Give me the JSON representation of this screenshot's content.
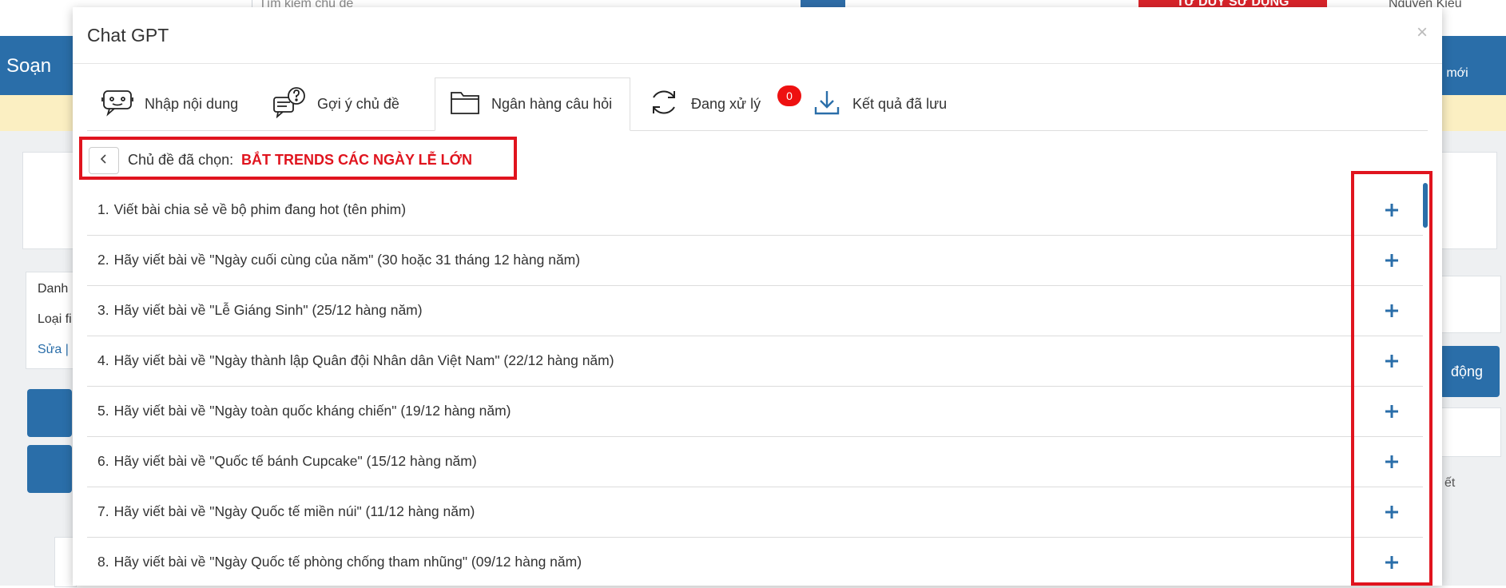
{
  "background": {
    "search_placeholder": "Tìm kiếm chủ đề",
    "promo_label": "TƯ DUY SỬ DỤNG",
    "user_name": "Nguyen Kieu",
    "left_nav_label": "Soạn",
    "right_nav_label": "u mới",
    "list_items": [
      "Danh",
      "Loại fi",
      "Sửa |"
    ],
    "right_button_label": "động",
    "right_text": "ết"
  },
  "modal": {
    "title": "Chat GPT",
    "close_glyph": "×"
  },
  "tabs": [
    {
      "label": "Nhập nội dung",
      "icon": "chat-bot-icon"
    },
    {
      "label": "Gợi ý chủ đề",
      "icon": "question-chat-icon"
    },
    {
      "label": "Ngân hàng câu hỏi",
      "icon": "folder-icon",
      "active": true
    },
    {
      "label": "Đang xử lý",
      "icon": "refresh-icon",
      "badge": "0"
    },
    {
      "label": "Kết quả đã lưu",
      "icon": "download-icon"
    }
  ],
  "selected": {
    "label": "Chủ đề đã chọn:",
    "topic": "BẮT TRENDS CÁC NGÀY LỄ LỚN"
  },
  "questions": [
    {
      "num": "1.",
      "text": "Viết bài chia sẻ về bộ phim đang hot (tên phim)"
    },
    {
      "num": "2.",
      "text": "Hãy viết bài về \"Ngày cuối cùng của năm\" (30 hoặc 31 tháng 12 hàng năm)"
    },
    {
      "num": "3.",
      "text": "Hãy viết bài về \"Lễ Giáng Sinh\" (25/12 hàng năm)"
    },
    {
      "num": "4.",
      "text": "Hãy viết bài về \"Ngày thành lập Quân đội Nhân dân Việt Nam\" (22/12 hàng năm)"
    },
    {
      "num": "5.",
      "text": "Hãy viết bài về \"Ngày toàn quốc kháng chiến\" (19/12 hàng năm)"
    },
    {
      "num": "6.",
      "text": "Hãy viết bài về \"Quốc tế bánh Cupcake\" (15/12 hàng năm)"
    },
    {
      "num": "7.",
      "text": "Hãy viết bài về \"Ngày Quốc tế miền núi\" (11/12 hàng năm)"
    },
    {
      "num": "8.",
      "text": "Hãy viết bài về \"Ngày Quốc tế phòng chống tham nhũng\" (09/12 hàng năm)"
    }
  ],
  "colors": {
    "accent": "#e0141e",
    "brand_blue": "#2a6ea9",
    "badge": "#ee1111"
  }
}
